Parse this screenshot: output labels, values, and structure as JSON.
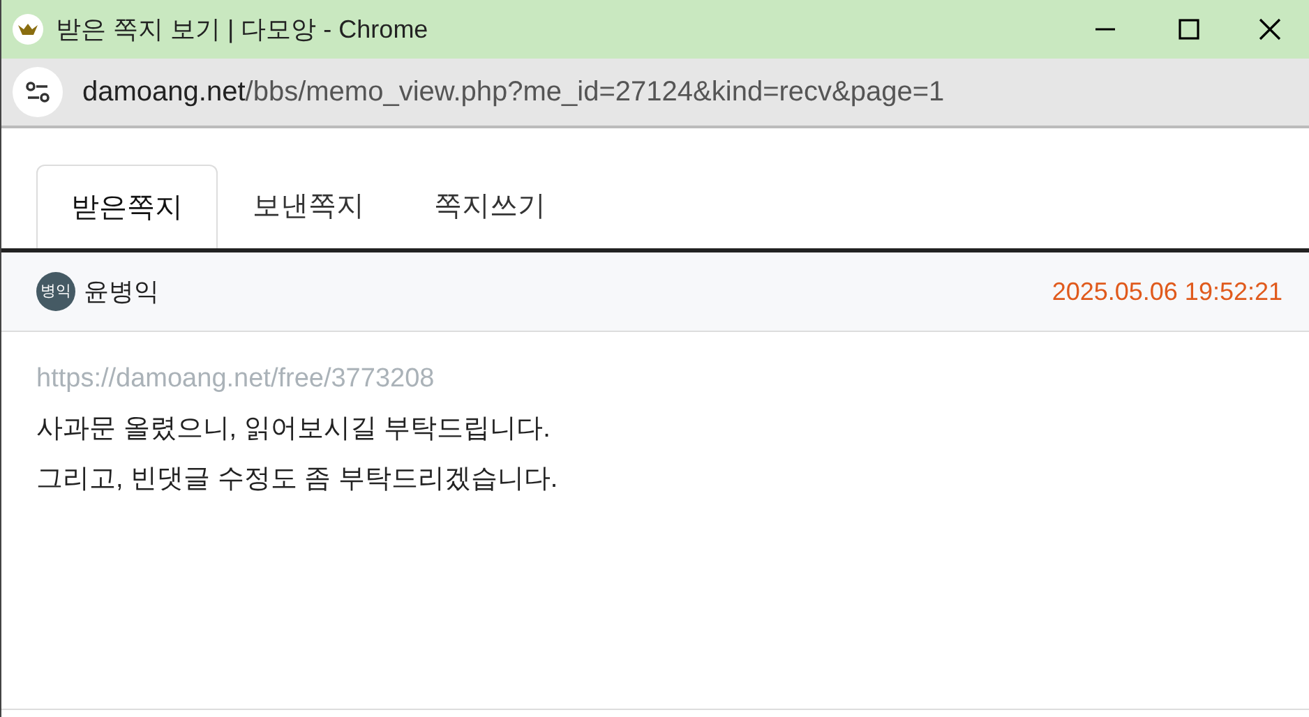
{
  "window": {
    "title": "받은 쪽지 보기 | 다모앙 - Chrome"
  },
  "address_bar": {
    "host": "damoang.net",
    "path": "/bbs/memo_view.php?me_id=27124&kind=recv&page=1"
  },
  "tabs": [
    {
      "label": "받은쪽지",
      "selected": true
    },
    {
      "label": "보낸쪽지",
      "selected": false
    },
    {
      "label": "쪽지쓰기",
      "selected": false
    }
  ],
  "memo": {
    "sender": {
      "avatar_text": "병익",
      "name": "윤병익"
    },
    "datetime": "2025.05.06 19:52:21",
    "link": "https://damoang.net/free/3773208",
    "lines": [
      "사과문 올렸으니, 읽어보시길 부탁드립니다.",
      "그리고, 빈댓글 수정도 좀 부탁드리겠습니다."
    ]
  }
}
